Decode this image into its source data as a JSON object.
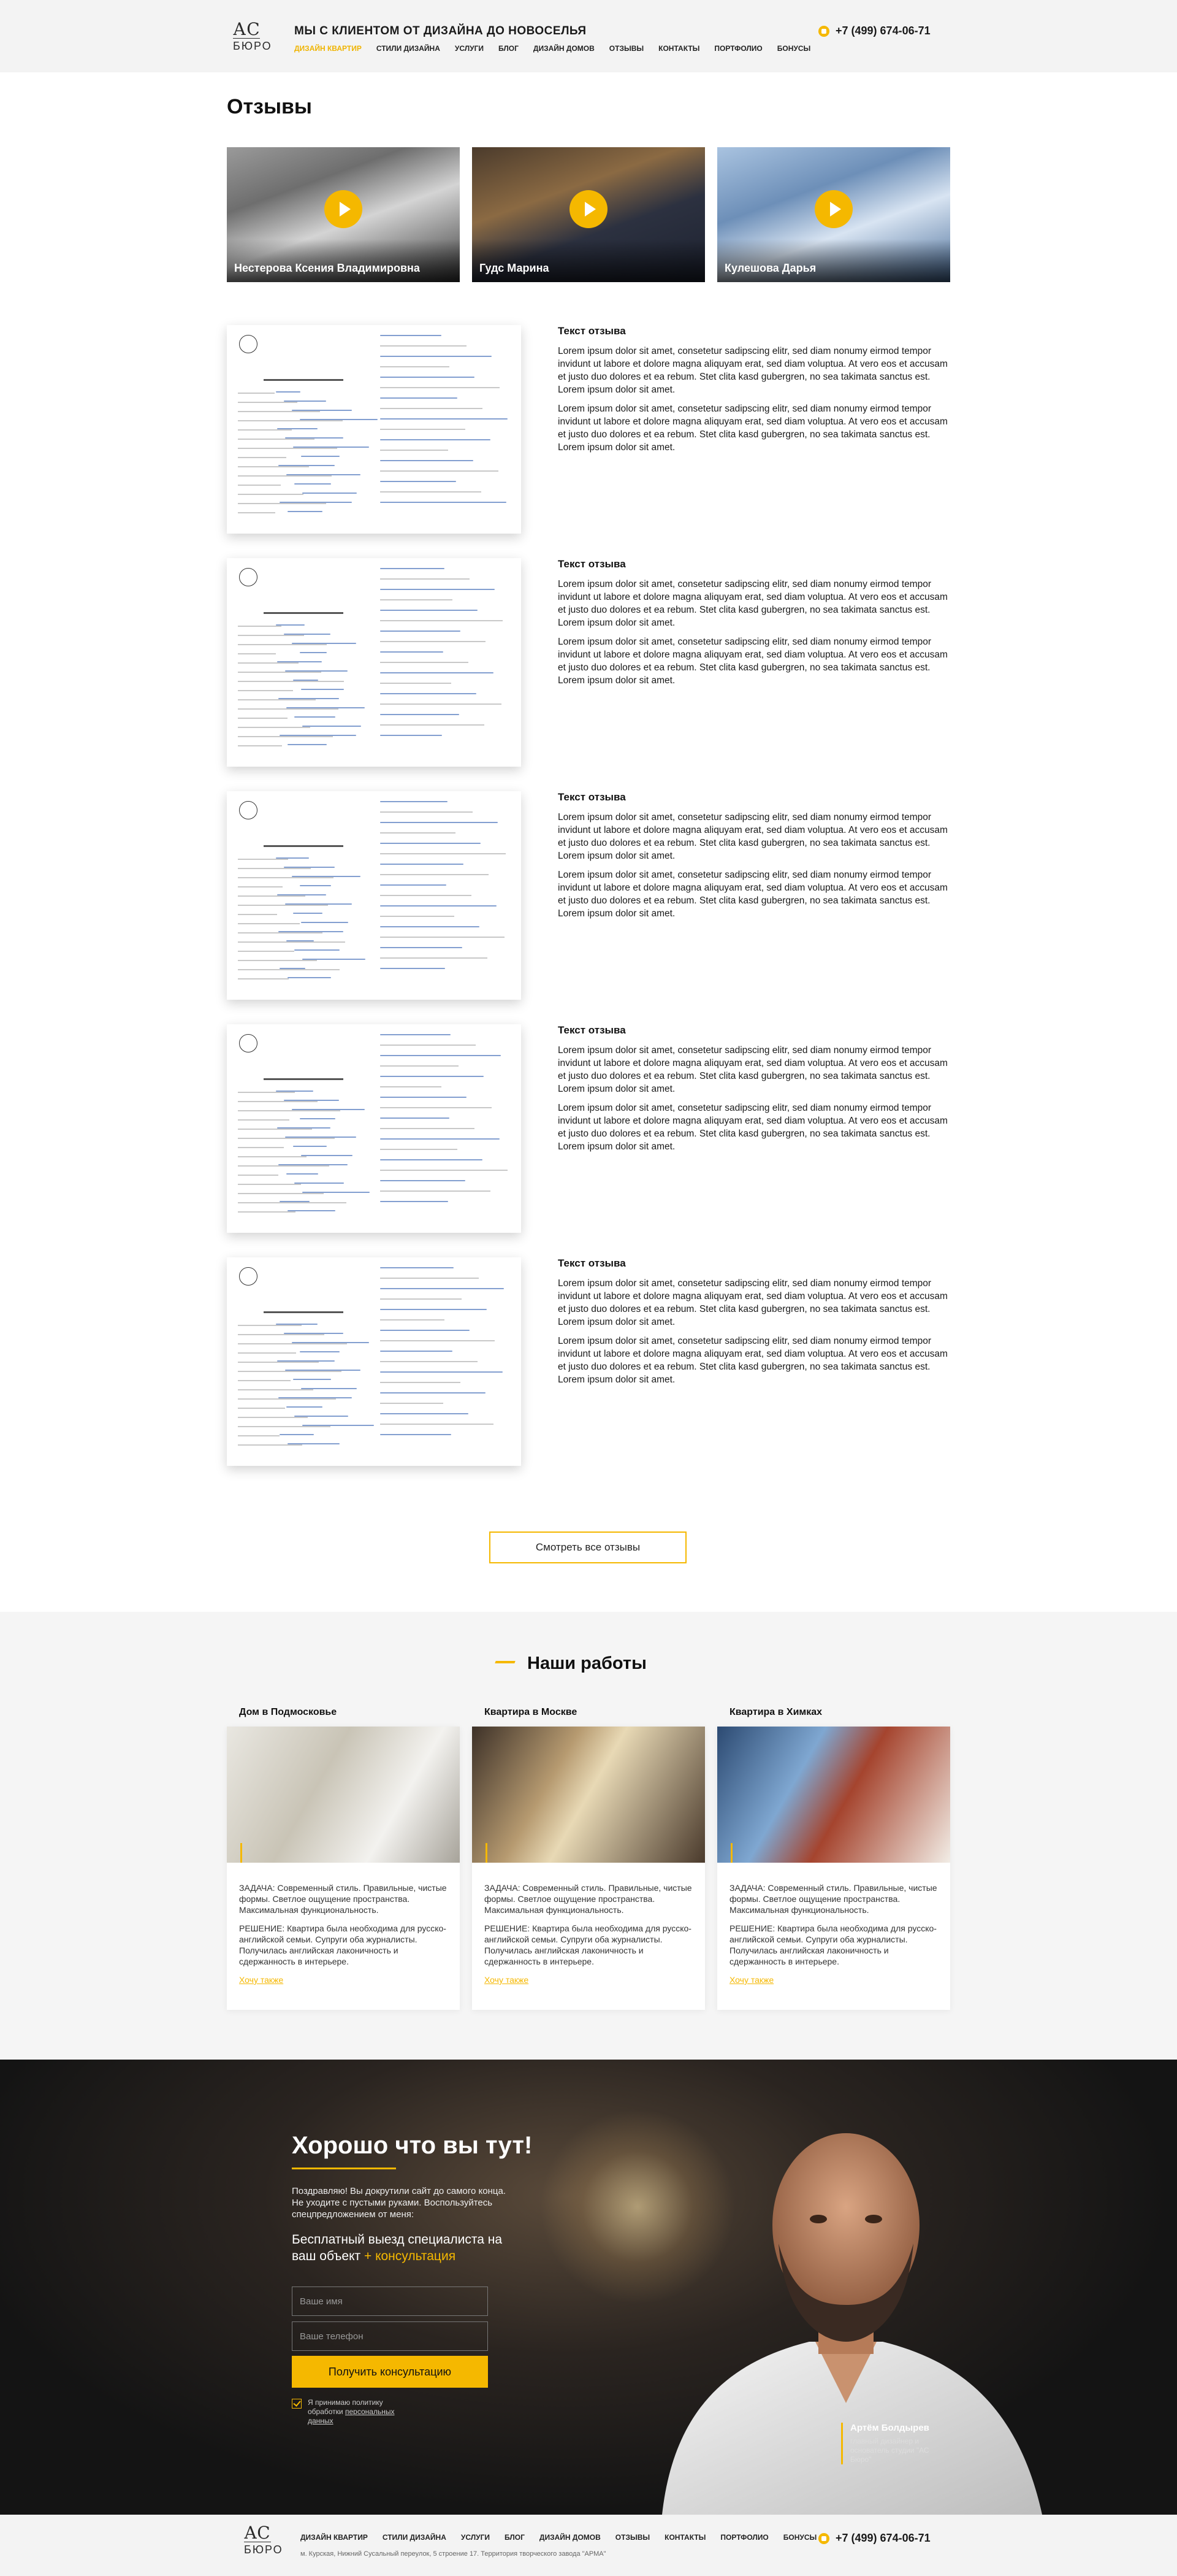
{
  "header": {
    "logo_top": "АС",
    "logo_bottom": "БЮРО",
    "tagline": "МЫ С КЛИЕНТОМ ОТ ДИЗАЙНА ДО НОВОСЕЛЬЯ",
    "nav": [
      "ДИЗАЙН КВАРТИР",
      "СТИЛИ ДИЗАЙНА",
      "УСЛУГИ",
      "БЛОГ",
      "ДИЗАЙН ДОМОВ",
      "ОТЗЫВЫ",
      "КОНТАКТЫ",
      "ПОРТФОЛИО",
      "БОНУСЫ"
    ],
    "active_nav": "ДИЗАЙН КВАРТИР",
    "phone": "+7 (499) 674-06-71"
  },
  "reviews_section": {
    "title": "Отзывы",
    "video_reviews": [
      {
        "name": "Нестерова Ксения Владимировна"
      },
      {
        "name": "Гудс Марина"
      },
      {
        "name": "Кулешова Дарья"
      }
    ],
    "items": [
      {
        "title": "Текст отзыва",
        "paragraphs": [
          "Lorem ipsum dolor sit amet, consetetur sadipscing elitr, sed diam nonumy eirmod tempor invidunt ut labore et dolore magna aliquyam erat, sed diam voluptua. At vero eos et accusam et justo duo dolores et ea rebum. Stet clita kasd gubergren, no sea takimata sanctus est. Lorem ipsum dolor sit amet.",
          "Lorem ipsum dolor sit amet, consetetur sadipscing elitr, sed diam nonumy eirmod tempor invidunt ut labore et dolore magna aliquyam erat, sed diam voluptua. At vero eos et accusam et justo duo dolores et ea rebum. Stet clita kasd gubergren, no sea takimata sanctus est. Lorem ipsum dolor sit amet."
        ]
      },
      {
        "title": "Текст отзыва",
        "paragraphs": [
          "Lorem ipsum dolor sit amet, consetetur sadipscing elitr, sed diam nonumy eirmod tempor invidunt ut labore et dolore magna aliquyam erat, sed diam voluptua. At vero eos et accusam et justo duo dolores et ea rebum. Stet clita kasd gubergren, no sea takimata sanctus est. Lorem ipsum dolor sit amet.",
          "Lorem ipsum dolor sit amet, consetetur sadipscing elitr, sed diam nonumy eirmod tempor invidunt ut labore et dolore magna aliquyam erat, sed diam voluptua. At vero eos et accusam et justo duo dolores et ea rebum. Stet clita kasd gubergren, no sea takimata sanctus est. Lorem ipsum dolor sit amet."
        ]
      },
      {
        "title": "Текст отзыва",
        "paragraphs": [
          "Lorem ipsum dolor sit amet, consetetur sadipscing elitr, sed diam nonumy eirmod tempor invidunt ut labore et dolore magna aliquyam erat, sed diam voluptua. At vero eos et accusam et justo duo dolores et ea rebum. Stet clita kasd gubergren, no sea takimata sanctus est. Lorem ipsum dolor sit amet.",
          "Lorem ipsum dolor sit amet, consetetur sadipscing elitr, sed diam nonumy eirmod tempor invidunt ut labore et dolore magna aliquyam erat, sed diam voluptua. At vero eos et accusam et justo duo dolores et ea rebum. Stet clita kasd gubergren, no sea takimata sanctus est. Lorem ipsum dolor sit amet."
        ]
      },
      {
        "title": "Текст отзыва",
        "paragraphs": [
          "Lorem ipsum dolor sit amet, consetetur sadipscing elitr, sed diam nonumy eirmod tempor invidunt ut labore et dolore magna aliquyam erat, sed diam voluptua. At vero eos et accusam et justo duo dolores et ea rebum. Stet clita kasd gubergren, no sea takimata sanctus est. Lorem ipsum dolor sit amet.",
          "Lorem ipsum dolor sit amet, consetetur sadipscing elitr, sed diam nonumy eirmod tempor invidunt ut labore et dolore magna aliquyam erat, sed diam voluptua. At vero eos et accusam et justo duo dolores et ea rebum. Stet clita kasd gubergren, no sea takimata sanctus est. Lorem ipsum dolor sit amet."
        ]
      },
      {
        "title": "Текст отзыва",
        "paragraphs": [
          "Lorem ipsum dolor sit amet, consetetur sadipscing elitr, sed diam nonumy eirmod tempor invidunt ut labore et dolore magna aliquyam erat, sed diam voluptua. At vero eos et accusam et justo duo dolores et ea rebum. Stet clita kasd gubergren, no sea takimata sanctus est. Lorem ipsum dolor sit amet.",
          "Lorem ipsum dolor sit amet, consetetur sadipscing elitr, sed diam nonumy eirmod tempor invidunt ut labore et dolore magna aliquyam erat, sed diam voluptua. At vero eos et accusam et justo duo dolores et ea rebum. Stet clita kasd gubergren, no sea takimata sanctus est. Lorem ipsum dolor sit amet."
        ]
      }
    ],
    "all_reviews_button": "Смотреть все отзывы"
  },
  "works_section": {
    "title": "Наши работы",
    "items": [
      {
        "title": "Дом в Подмосковье",
        "task": "ЗАДАЧА: Современный стиль. Правильные, чистые формы. Светлое ощущение пространства. Максимальная функциональность.",
        "solution": "РЕШЕНИЕ: Квартира была необходима для русско-английской семьи. Супруги оба журналисты. Получилась английская лаконичность и сдержанность в интерьере.",
        "link": "Хочу также"
      },
      {
        "title": "Квартира в Москве",
        "task": "ЗАДАЧА: Современный стиль. Правильные, чистые формы. Светлое ощущение пространства. Максимальная функциональность.",
        "solution": "РЕШЕНИЕ: Квартира была необходима для русско-английской семьи. Супруги оба журналисты. Получилась английская лаконичность и сдержанность в интерьере.",
        "link": "Хочу также"
      },
      {
        "title": "Квартира в Химках",
        "task": "ЗАДАЧА: Современный стиль. Правильные, чистые формы. Светлое ощущение пространства. Максимальная функциональность.",
        "solution": "РЕШЕНИЕ: Квартира была необходима для русско-английской семьи. Супруги оба журналисты. Получилась английская лаконичность и сдержанность в интерьере.",
        "link": "Хочу также"
      }
    ]
  },
  "cta": {
    "title": "Хорошо что вы тут!",
    "text": "Поздравляю! Вы докрутили сайт до самого конца. Не уходите с пустыми руками. Воспользуйтесь спецпредложением от меня:",
    "offer_main": "Бесплатный выезд специалиста на ваш объект",
    "offer_highlight": "+ консультация",
    "name_placeholder": "Ваше имя",
    "phone_placeholder": "Ваше телефон",
    "button": "Получить консультацию",
    "consent_text": "Я принимаю политику обработки",
    "consent_link": "персональных данных",
    "person_name": "Артём Болдырев",
    "person_role": "главный дизайнер и основатель студии \"АС Бюро\""
  },
  "footer": {
    "logo_top": "АС",
    "logo_bottom": "БЮРО",
    "nav": [
      "ДИЗАЙН КВАРТИР",
      "СТИЛИ ДИЗАЙНА",
      "УСЛУГИ",
      "БЛОГ",
      "ДИЗАЙН ДОМОВ",
      "ОТЗЫВЫ",
      "КОНТАКТЫ",
      "ПОРТФОЛИО",
      "БОНУСЫ"
    ],
    "address": "м. Курская, Нижний Сусальный переулок, 5 строение 17. Территория творческого завода \"АРМА\"",
    "phone": "+7 (499) 674-06-71"
  },
  "colors": {
    "accent": "#f5b800",
    "dark_bg": "#141414",
    "light_bg": "#f3f3f3"
  }
}
